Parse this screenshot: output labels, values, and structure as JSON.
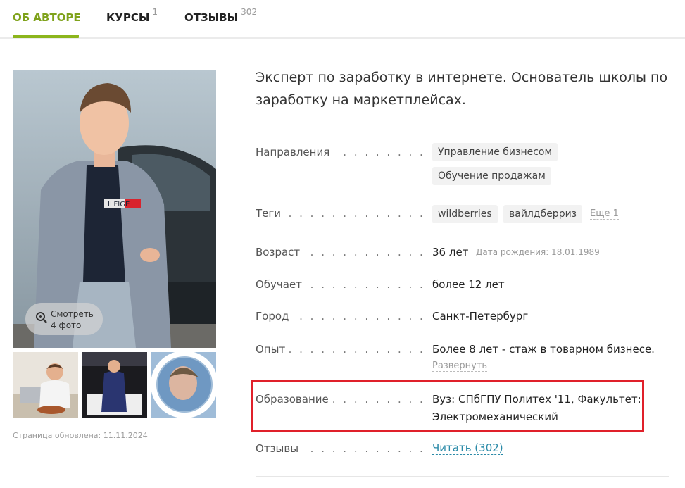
{
  "tabs": [
    {
      "label": "ОБ АВТОРЕ",
      "count": ""
    },
    {
      "label": "КУРСЫ",
      "count": "1"
    },
    {
      "label": "ОТЗЫВЫ",
      "count": "302"
    }
  ],
  "photo": {
    "view_line1": "Смотреть",
    "view_line2": "4 фото",
    "shirt_text": "ILFIGE"
  },
  "updated": "Страница обновлена: 11.11.2024",
  "bio": "Эксперт по заработку в интернете. Основатель школы по заработку на маркетплейсах.",
  "rows": {
    "directions": {
      "label": "Направления",
      "items": [
        "Управление бизнесом",
        "Обучение продажам"
      ]
    },
    "tags": {
      "label": "Теги",
      "items": [
        "wildberries",
        "вайлдберриз"
      ],
      "more": "Еще 1"
    },
    "age": {
      "label": "Возраст",
      "value": "36 лет",
      "sub": "Дата рождения: 18.01.1989"
    },
    "teaches": {
      "label": "Обучает",
      "value": "более 12 лет"
    },
    "city": {
      "label": "Город",
      "value": "Санкт-Петербург"
    },
    "experience": {
      "label": "Опыт",
      "value": "Более 8 лет - стаж в товарном бизнесе.",
      "expand": "Развернуть"
    },
    "education": {
      "label": "Образование",
      "line1": "Вуз: СПбГПУ Политех '11, Факультет:",
      "line2": "Электромеханический"
    },
    "reviews": {
      "label": "Отзывы",
      "link": "Читать (302)"
    }
  },
  "colors": {
    "accent": "#8cb51c",
    "link": "#2a8aa8",
    "highlight": "#e0202a"
  }
}
